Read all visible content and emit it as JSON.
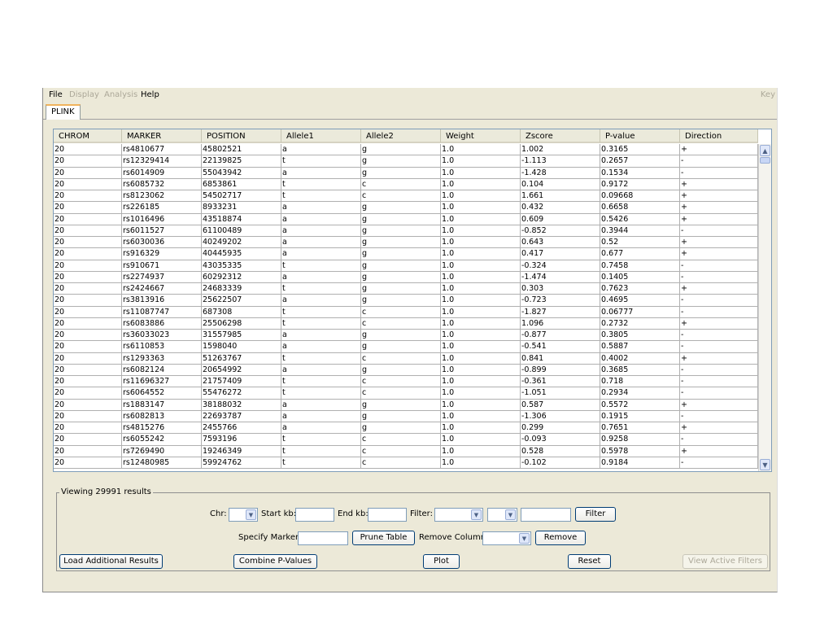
{
  "menu": {
    "file": "File",
    "display": "Display",
    "analysis": "Analysis",
    "help": "Help",
    "key": "Key"
  },
  "tabs": [
    {
      "label": "PLINK"
    }
  ],
  "table": {
    "columns": [
      "CHROM",
      "MARKER",
      "POSITION",
      "Allele1",
      "Allele2",
      "Weight",
      "Zscore",
      "P-value",
      "Direction"
    ],
    "rows": [
      [
        "20",
        "rs4810677",
        "45802521",
        "a",
        "g",
        "1.0",
        "1.002",
        "0.3165",
        "+"
      ],
      [
        "20",
        "rs12329414",
        "22139825",
        "t",
        "g",
        "1.0",
        "-1.113",
        "0.2657",
        "-"
      ],
      [
        "20",
        "rs6014909",
        "55043942",
        "a",
        "g",
        "1.0",
        "-1.428",
        "0.1534",
        "-"
      ],
      [
        "20",
        "rs6085732",
        "6853861",
        "t",
        "c",
        "1.0",
        "0.104",
        "0.9172",
        "+"
      ],
      [
        "20",
        "rs8123062",
        "54502717",
        "t",
        "c",
        "1.0",
        "1.661",
        "0.09668",
        "+"
      ],
      [
        "20",
        "rs226185",
        "8933231",
        "a",
        "g",
        "1.0",
        "0.432",
        "0.6658",
        "+"
      ],
      [
        "20",
        "rs1016496",
        "43518874",
        "a",
        "g",
        "1.0",
        "0.609",
        "0.5426",
        "+"
      ],
      [
        "20",
        "rs6011527",
        "61100489",
        "a",
        "g",
        "1.0",
        "-0.852",
        "0.3944",
        "-"
      ],
      [
        "20",
        "rs6030036",
        "40249202",
        "a",
        "g",
        "1.0",
        "0.643",
        "0.52",
        "+"
      ],
      [
        "20",
        "rs916329",
        "40445935",
        "a",
        "g",
        "1.0",
        "0.417",
        "0.677",
        "+"
      ],
      [
        "20",
        "rs910671",
        "43035335",
        "t",
        "g",
        "1.0",
        "-0.324",
        "0.7458",
        "-"
      ],
      [
        "20",
        "rs2274937",
        "60292312",
        "a",
        "g",
        "1.0",
        "-1.474",
        "0.1405",
        "-"
      ],
      [
        "20",
        "rs2424667",
        "24683339",
        "t",
        "g",
        "1.0",
        "0.303",
        "0.7623",
        "+"
      ],
      [
        "20",
        "rs3813916",
        "25622507",
        "a",
        "g",
        "1.0",
        "-0.723",
        "0.4695",
        "-"
      ],
      [
        "20",
        "rs11087747",
        "687308",
        "t",
        "c",
        "1.0",
        "-1.827",
        "0.06777",
        "-"
      ],
      [
        "20",
        "rs6083886",
        "25506298",
        "t",
        "c",
        "1.0",
        "1.096",
        "0.2732",
        "+"
      ],
      [
        "20",
        "rs36033023",
        "31557985",
        "a",
        "g",
        "1.0",
        "-0.877",
        "0.3805",
        "-"
      ],
      [
        "20",
        "rs6110853",
        "1598040",
        "a",
        "g",
        "1.0",
        "-0.541",
        "0.5887",
        "-"
      ],
      [
        "20",
        "rs1293363",
        "51263767",
        "t",
        "c",
        "1.0",
        "0.841",
        "0.4002",
        "+"
      ],
      [
        "20",
        "rs6082124",
        "20654992",
        "a",
        "g",
        "1.0",
        "-0.899",
        "0.3685",
        "-"
      ],
      [
        "20",
        "rs11696327",
        "21757409",
        "t",
        "c",
        "1.0",
        "-0.361",
        "0.718",
        "-"
      ],
      [
        "20",
        "rs6064552",
        "55476272",
        "t",
        "c",
        "1.0",
        "-1.051",
        "0.2934",
        "-"
      ],
      [
        "20",
        "rs1883147",
        "38188032",
        "a",
        "g",
        "1.0",
        "0.587",
        "0.5572",
        "+"
      ],
      [
        "20",
        "rs6082813",
        "22693787",
        "a",
        "g",
        "1.0",
        "-1.306",
        "0.1915",
        "-"
      ],
      [
        "20",
        "rs4815276",
        "2455766",
        "a",
        "g",
        "1.0",
        "0.299",
        "0.7651",
        "+"
      ],
      [
        "20",
        "rs6055242",
        "7593196",
        "t",
        "c",
        "1.0",
        "-0.093",
        "0.9258",
        "-"
      ],
      [
        "20",
        "rs7269490",
        "19246349",
        "t",
        "c",
        "1.0",
        "0.528",
        "0.5978",
        "+"
      ],
      [
        "20",
        "rs12480985",
        "59924762",
        "t",
        "c",
        "1.0",
        "-0.102",
        "0.9184",
        "-"
      ]
    ]
  },
  "scrollbar_icons": {
    "up": "scroll-up-arrow-icon",
    "down": "scroll-down-arrow-icon"
  },
  "filter_panel": {
    "title": "Viewing 29991 results",
    "chr_label": "Chr:",
    "chr_value": "",
    "start_kb_label": "Start kb:",
    "start_kb_value": "",
    "end_kb_label": "End kb:",
    "end_kb_value": "",
    "filter_label": "Filter:",
    "filter_column_value": "",
    "filter_operator_value": "",
    "filter_value": "",
    "filter_button": "Filter",
    "specify_marker_label": "Specify Marker:",
    "specify_marker_value": "",
    "prune_table_button": "Prune Table",
    "remove_column_label": "Remove Column:",
    "remove_column_value": "",
    "remove_button": "Remove"
  },
  "bottom_buttons": {
    "load_additional": "Load Additional Results",
    "combine_pvalues": "Combine P-Values",
    "plot": "Plot",
    "reset": "Reset",
    "view_active_filters": "View Active Filters"
  },
  "colors": {
    "window_bg": "#ece9d8",
    "tab_accent": "#f0b35c",
    "disabled_text": "#aca899",
    "button_border": "#003c74"
  }
}
